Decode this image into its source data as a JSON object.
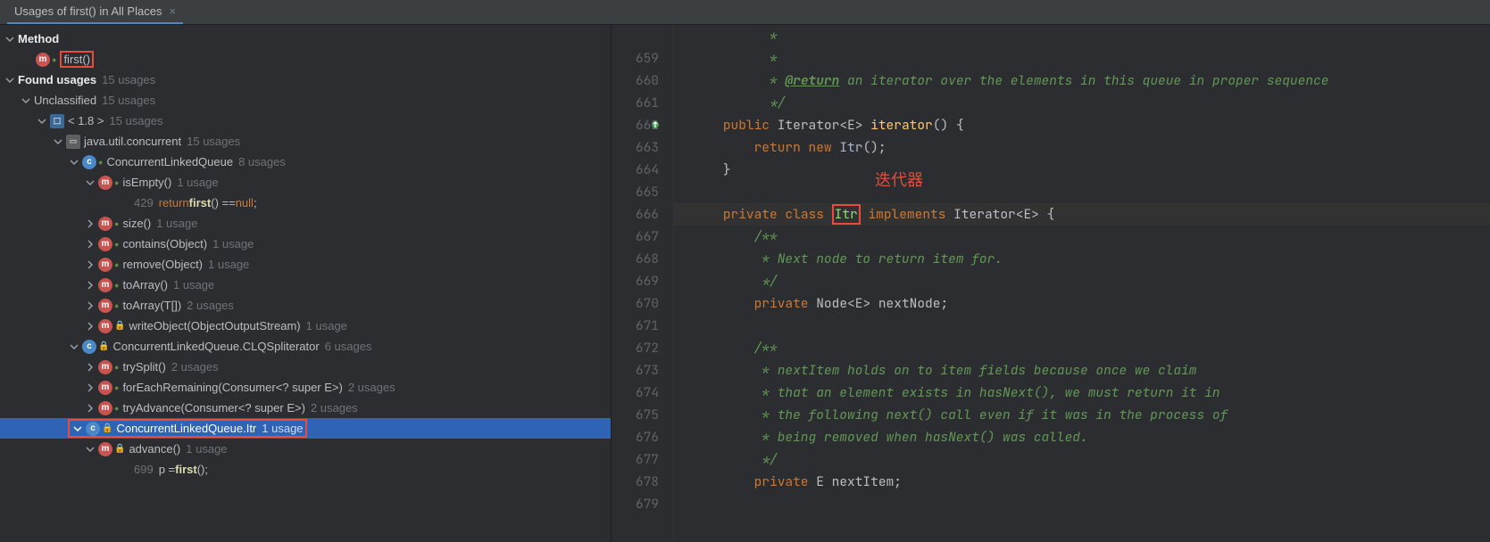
{
  "tab": {
    "title": "Usages of first() in All Places"
  },
  "tree": {
    "method_heading": "Method",
    "method_name": "first()",
    "found_heading": "Found usages",
    "found_count": "15 usages",
    "unclassified": "Unclassified",
    "unclassified_count": "15 usages",
    "jdk": "< 1.8 >",
    "jdk_count": "15 usages",
    "pkg": "java.util.concurrent",
    "pkg_count": "15 usages",
    "class1": "ConcurrentLinkedQueue",
    "class1_count": "8 usages",
    "isEmpty": "isEmpty()",
    "isEmpty_count": "1 usage",
    "isEmpty_line": "429",
    "isEmpty_code_pre": "return ",
    "isEmpty_code_call": "first",
    "isEmpty_code_post": "() == ",
    "isEmpty_code_null": "null",
    "isEmpty_code_end": ";",
    "size": "size()",
    "size_count": "1 usage",
    "contains": "contains(Object)",
    "contains_count": "1 usage",
    "remove": "remove(Object)",
    "remove_count": "1 usage",
    "toArray0": "toArray()",
    "toArray0_count": "1 usage",
    "toArrayT": "toArray(T[])",
    "toArrayT_count": "2 usages",
    "writeObject": "writeObject(ObjectOutputStream)",
    "writeObject_count": "1 usage",
    "class2": "ConcurrentLinkedQueue.CLQSpliterator",
    "class2_count": "6 usages",
    "trySplit": "trySplit()",
    "trySplit_count": "2 usages",
    "forEachRemaining": "forEachRemaining(Consumer<? super E>)",
    "forEachRemaining_count": "2 usages",
    "tryAdvance": "tryAdvance(Consumer<? super E>)",
    "tryAdvance_count": "2 usages",
    "class3": "ConcurrentLinkedQueue.Itr",
    "class3_count": "1 usage",
    "advance": "advance()",
    "advance_count": "1 usage",
    "advance_line": "699",
    "advance_code_pre": "p = ",
    "advance_code_call": "first",
    "advance_code_post": "();"
  },
  "annotation": "迭代器",
  "code": {
    "lines": [
      {
        "n": "",
        "html": "c0"
      },
      {
        "n": "659",
        "html": "c1"
      },
      {
        "n": "660",
        "html": "c2"
      },
      {
        "n": "661",
        "html": "c3"
      },
      {
        "n": "662",
        "html": "c4",
        "mark": true
      },
      {
        "n": "663",
        "html": "c5"
      },
      {
        "n": "664",
        "html": "c6"
      },
      {
        "n": "665",
        "html": "c7"
      },
      {
        "n": "666",
        "html": "c8",
        "current": true
      },
      {
        "n": "667",
        "html": "c9"
      },
      {
        "n": "668",
        "html": "c10"
      },
      {
        "n": "669",
        "html": "c11"
      },
      {
        "n": "670",
        "html": "c12"
      },
      {
        "n": "671",
        "html": "c13"
      },
      {
        "n": "672",
        "html": "c14"
      },
      {
        "n": "673",
        "html": "c15"
      },
      {
        "n": "674",
        "html": "c16"
      },
      {
        "n": "675",
        "html": "c17"
      },
      {
        "n": "676",
        "html": "c18"
      },
      {
        "n": "677",
        "html": "c19"
      },
      {
        "n": "678",
        "html": "c20"
      },
      {
        "n": "679",
        "html": "c21"
      }
    ],
    "c0": " *",
    "c1": " *",
    "c2_pre": " * ",
    "c2_tag": "@return",
    "c2_post": " an iterator over the elements in this queue in proper sequence",
    "c3": " */",
    "c4": "public Iterator<E> iterator() {",
    "c5": "    return new Itr();",
    "c6": "}",
    "c7": "",
    "c8": "private class Itr implements Iterator<E> {",
    "c9": "    /**",
    "c10": "     * Next node to return item for.",
    "c11": "     */",
    "c12": "    private Node<E> nextNode;",
    "c13": "",
    "c14": "    /**",
    "c15": "     * nextItem holds on to item fields because once we claim",
    "c16": "     * that an element exists in hasNext(), we must return it in",
    "c17": "     * the following next() call even if it was in the process of",
    "c18": "     * being removed when hasNext() was called.",
    "c19": "     */",
    "c20": "    private E nextItem;",
    "c21": ""
  }
}
